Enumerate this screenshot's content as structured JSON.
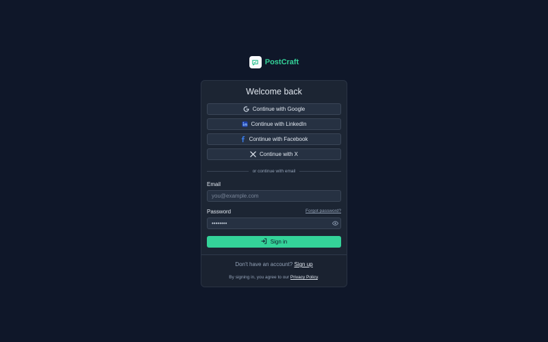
{
  "brand": {
    "name": "PostCraft",
    "logo_icon": "chat-bubble-icon"
  },
  "card": {
    "title": "Welcome back"
  },
  "social": [
    {
      "label": "Continue with Google",
      "icon": "google-icon"
    },
    {
      "label": "Continue with LinkedIn",
      "icon": "linkedin-icon"
    },
    {
      "label": "Continue with Facebook",
      "icon": "facebook-icon"
    },
    {
      "label": "Continue with X",
      "icon": "x-icon"
    }
  ],
  "divider": {
    "text": "or continue with email"
  },
  "form": {
    "email_label": "Email",
    "email_placeholder": "you@example.com",
    "email_value": "",
    "password_label": "Password",
    "forgot_label": "Forgot password?",
    "password_value": "password",
    "submit_label": "Sign in"
  },
  "footer": {
    "signup_prompt": "Don't have an account?",
    "signup_link": "Sign up",
    "policy_prefix": "By signing in, you agree to our",
    "policy_link": "Privacy Policy",
    "policy_suffix": "."
  },
  "colors": {
    "background": "#0f1729",
    "card": "#1c2533",
    "accent": "#34d399",
    "facebook": "#3b82f6",
    "linkedin": "#3b82f6"
  }
}
